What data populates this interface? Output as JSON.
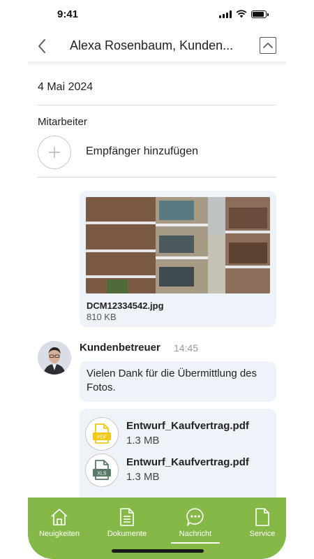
{
  "status_bar": {
    "time": "9:41"
  },
  "header": {
    "title": "Alexa Rosenbaum, Kunden..."
  },
  "date": "4 Mai 2024",
  "recipients": {
    "label": "Mitarbeiter",
    "add_label": "Empfänger hinzufügen"
  },
  "attachment": {
    "file_name": "DCM12334542.jpg",
    "file_size": "810 KB"
  },
  "message": {
    "sender": "Kundenbetreuer",
    "time": "14:45",
    "text": "Vielen Dank für die Übermittlung des Fotos."
  },
  "files": [
    {
      "name": "Entwurf_Kaufvertrag.pdf",
      "size": "1.3 MB",
      "badge": "PDF",
      "icon": "pdf-file-icon",
      "color": "#f2c811"
    },
    {
      "name": "Entwurf_Kaufvertrag.pdf",
      "size": "1.3 MB",
      "badge": "XLS",
      "icon": "xls-file-icon",
      "color": "#5a7a67"
    }
  ],
  "tabs": [
    {
      "label": "Neuigkeiten",
      "icon": "home-icon"
    },
    {
      "label": "Dokumente",
      "icon": "document-icon"
    },
    {
      "label": "Nachricht",
      "icon": "chat-icon",
      "active": true
    },
    {
      "label": "Service",
      "icon": "file-icon"
    }
  ],
  "colors": {
    "tab_bar": "#86b847",
    "bubble": "#eef3fa",
    "pdf": "#f2c811",
    "xls": "#5a7a67"
  }
}
